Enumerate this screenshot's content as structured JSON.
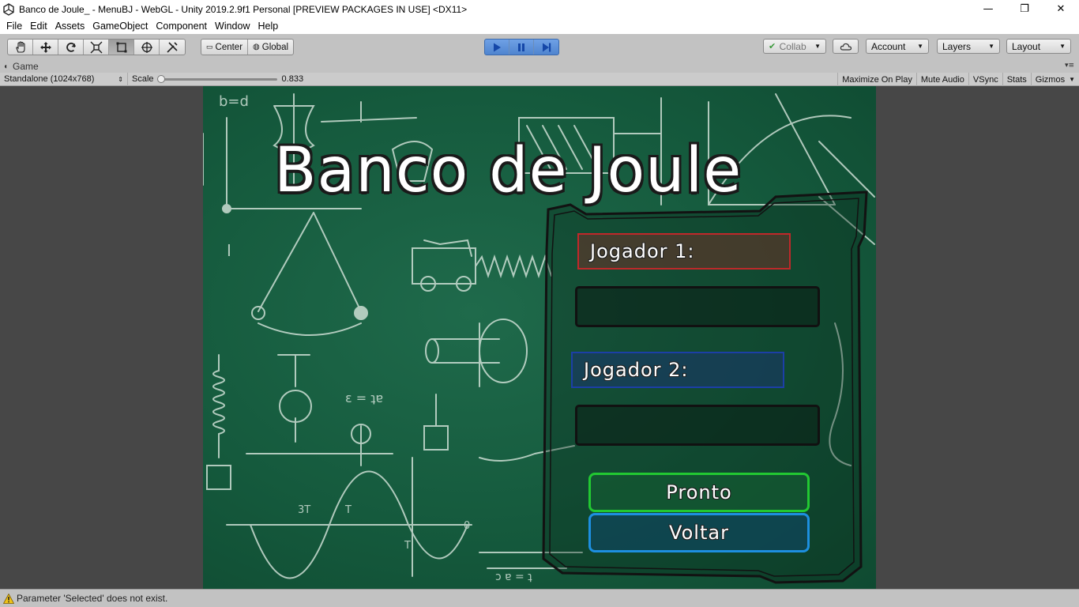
{
  "window": {
    "title": "Banco de Joule_ - MenuBJ - WebGL - Unity 2019.2.9f1 Personal [PREVIEW PACKAGES IN USE] <DX11>",
    "minimize": "—",
    "maximize": "❐",
    "close": "✕"
  },
  "menu": {
    "items": [
      "File",
      "Edit",
      "Assets",
      "GameObject",
      "Component",
      "Window",
      "Help"
    ]
  },
  "toolbar": {
    "pivot_center": "Center",
    "pivot_global": "Global",
    "collab": "Collab",
    "account": "Account",
    "layers": "Layers",
    "layout": "Layout"
  },
  "tab": {
    "label": "Game"
  },
  "gamebar": {
    "resolution": "Standalone (1024x768)",
    "scale_label": "Scale",
    "scale_value": "0.833",
    "maximize_on_play": "Maximize On Play",
    "mute_audio": "Mute Audio",
    "vsync": "VSync",
    "stats": "Stats",
    "gizmos": "Gizmos"
  },
  "game": {
    "title": "Banco de Joule",
    "player1_label": "Jogador 1:",
    "player2_label": "Jogador 2:",
    "player1_name": "",
    "player2_name": "",
    "ready_button": "Pronto",
    "back_button": "Voltar"
  },
  "status": {
    "message": "Parameter 'Selected' does not exist."
  },
  "colors": {
    "play_accent": "#4f84cf",
    "chalkboard": "#155a3d",
    "player1_border": "#c0282a",
    "player2_border": "#1c3fa6",
    "ready_border": "#22c832",
    "back_border": "#1d8fe0"
  }
}
